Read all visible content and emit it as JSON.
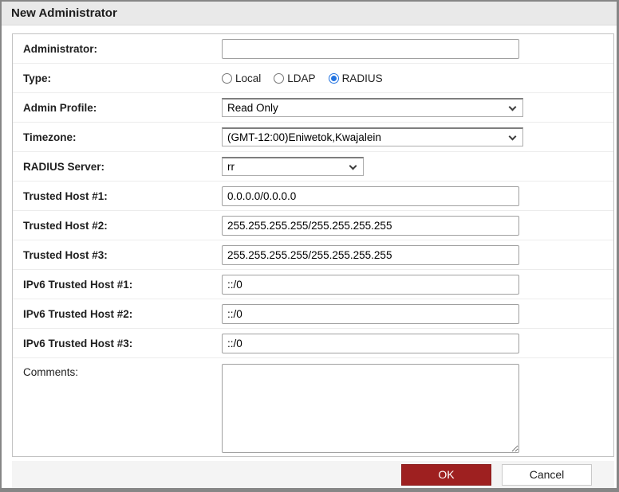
{
  "dialog": {
    "title": "New Administrator"
  },
  "form": {
    "rows": [
      {
        "label": "Administrator:",
        "type": "text",
        "value": ""
      },
      {
        "label": "Type:",
        "type": "radio-group"
      },
      {
        "label": "Admin Profile:",
        "type": "select",
        "value": "Read Only"
      },
      {
        "label": "Timezone:",
        "type": "select",
        "value": "(GMT-12:00)Eniwetok,Kwajalein"
      },
      {
        "label": "RADIUS Server:",
        "type": "select",
        "value": "rr"
      },
      {
        "label": "Trusted Host #1:",
        "type": "text",
        "value": "0.0.0.0/0.0.0.0"
      },
      {
        "label": "Trusted Host #2:",
        "type": "text",
        "value": "255.255.255.255/255.255.255.255"
      },
      {
        "label": "Trusted Host #3:",
        "type": "text",
        "value": "255.255.255.255/255.255.255.255"
      },
      {
        "label": "IPv6 Trusted Host #1:",
        "type": "text",
        "value": "::/0"
      },
      {
        "label": "IPv6 Trusted Host #2:",
        "type": "text",
        "value": "::/0"
      },
      {
        "label": "IPv6 Trusted Host #3:",
        "type": "text",
        "value": "::/0"
      },
      {
        "label": "Comments:",
        "type": "textarea",
        "value": ""
      }
    ],
    "type_options": [
      {
        "label": "Local",
        "selected": false
      },
      {
        "label": "LDAP",
        "selected": false
      },
      {
        "label": "RADIUS",
        "selected": true
      }
    ]
  },
  "footer": {
    "ok_label": "OK",
    "cancel_label": "Cancel"
  },
  "colors": {
    "ok_button": "#9e2020",
    "radio_selected": "#2374e1",
    "title_bar_bg": "#e9e9e9",
    "window_border": "#868686",
    "row_separator": "#ececec"
  }
}
